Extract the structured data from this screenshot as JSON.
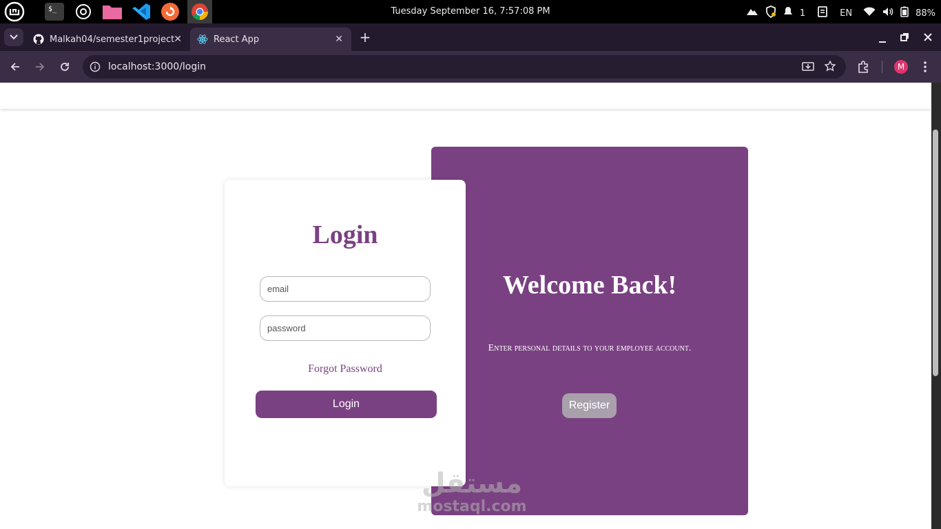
{
  "os": {
    "clock": "Tuesday September 16,  7:57:08 PM",
    "notifications": "1",
    "language": "EN",
    "battery": "88%"
  },
  "browser": {
    "tabs": [
      {
        "label": "Malkah04/semester1project",
        "icon": "github-icon"
      },
      {
        "label": "React App",
        "icon": "react-icon"
      }
    ],
    "url": "localhost:3000/login",
    "profile_initial": "M",
    "accent": "#7a4182"
  },
  "login": {
    "title": "Login",
    "email_placeholder": "email",
    "password_placeholder": "password",
    "forgot_label": "Forgot Password",
    "submit_label": "Login"
  },
  "welcome": {
    "title": "Welcome Back!",
    "subtitle": "Enter personal details to your employee account.",
    "register_label": "Register"
  },
  "watermark": {
    "arabic": "مستقل",
    "latin": "mostaql.com"
  }
}
